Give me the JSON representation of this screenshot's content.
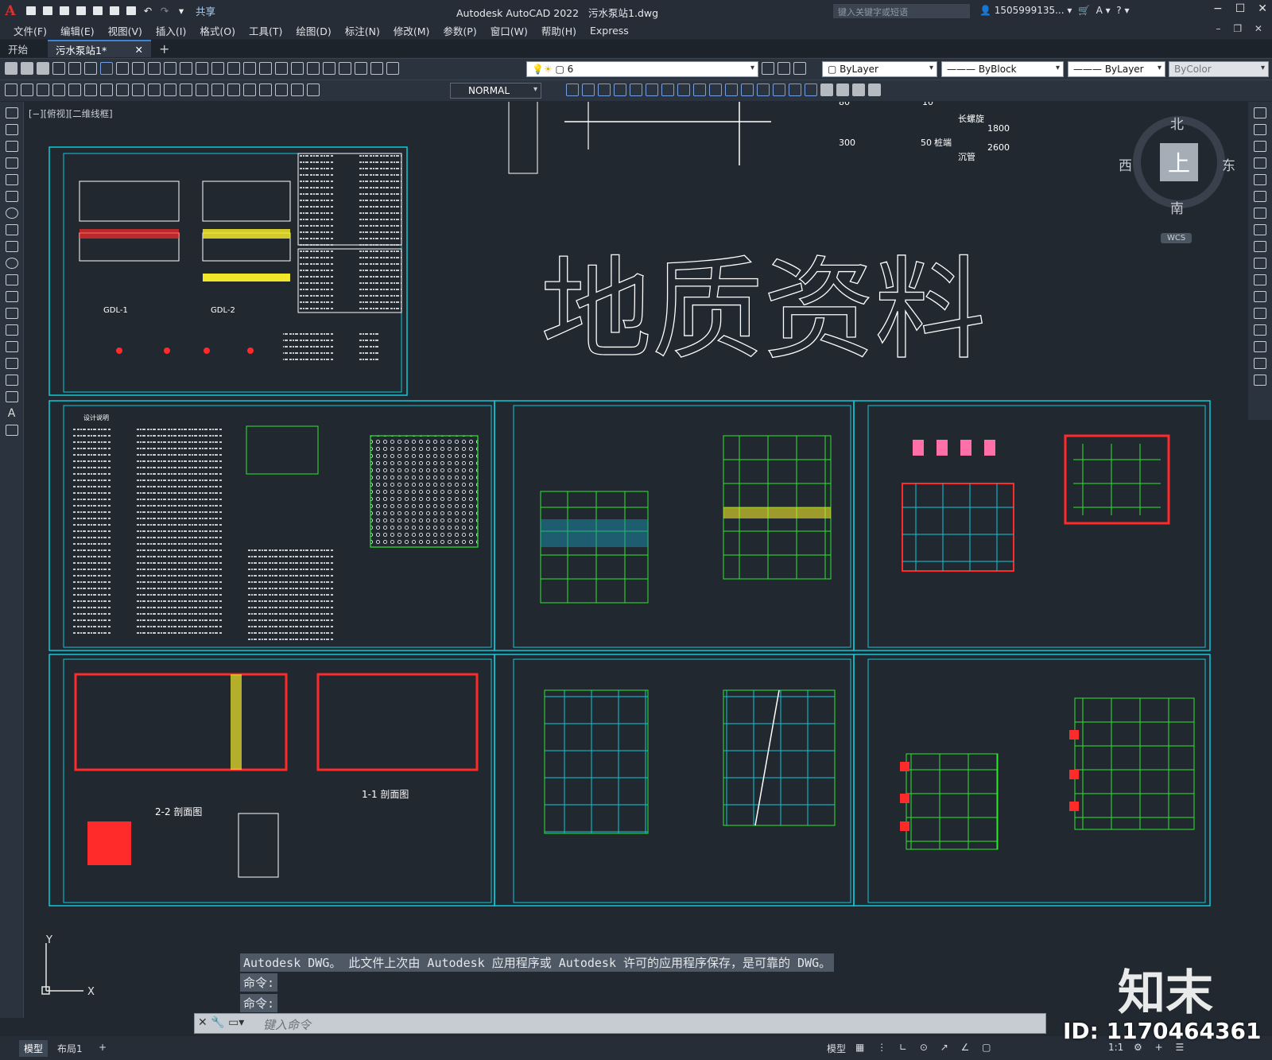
{
  "app": {
    "logo": "A",
    "title": "Autodesk AutoCAD 2022",
    "file": "污水泵站1.dwg",
    "share": "共享",
    "search_placeholder": "键入关键字或短语",
    "user": "1505999135...",
    "window_buttons": [
      "−",
      "☐",
      "✕"
    ]
  },
  "menu": [
    "文件(F)",
    "编辑(E)",
    "视图(V)",
    "插入(I)",
    "格式(O)",
    "工具(T)",
    "绘图(D)",
    "标注(N)",
    "修改(M)",
    "参数(P)",
    "窗口(W)",
    "帮助(H)",
    "Express"
  ],
  "tabs": {
    "start": "开始",
    "active": "污水泵站1*",
    "close": "✕",
    "add": "+"
  },
  "toolbar": {
    "layer_value": "6",
    "style_value": "NORMAL",
    "color_value": "ByLayer",
    "linetype_value": "ByBlock",
    "lineweight_value": "ByLayer",
    "plot_style_value": "ByColor"
  },
  "viewport_label": "[−][俯视][二维线框]",
  "drawing": {
    "big_title": "地质资料",
    "geo_left": [
      "300",
      "50"
    ],
    "geo_mid": [
      "80",
      "10",
      "桩端",
      "长螺旋",
      "沉管",
      "1800",
      "2600"
    ],
    "gdl": [
      "GDL-1",
      "GDL-2"
    ],
    "sections": [
      "2-2 剖面图",
      "1-1 剖面图"
    ],
    "notes_title": "设计说明"
  },
  "viewcube": {
    "north": "北",
    "south": "南",
    "east": "东",
    "west": "西",
    "top": "上",
    "wcs": "WCS"
  },
  "command": {
    "history_line1": "Autodesk DWG。 此文件上次由 Autodesk 应用程序或 Autodesk 许可的应用程序保存，是可靠的 DWG。",
    "history_line2": "命令:",
    "history_line3": "命令:",
    "placeholder": "键入命令"
  },
  "status": {
    "model_tab": "模型",
    "layout_tab": "布局1",
    "add": "+",
    "model_btn": "模型",
    "scale": "1:1"
  },
  "watermark": {
    "logo": "知末",
    "id": "ID: 1170464361"
  },
  "colors": {
    "frame": "#11c7d6",
    "green": "#2ee82e",
    "red": "#ff2a2a",
    "yellow": "#f2e82a"
  }
}
